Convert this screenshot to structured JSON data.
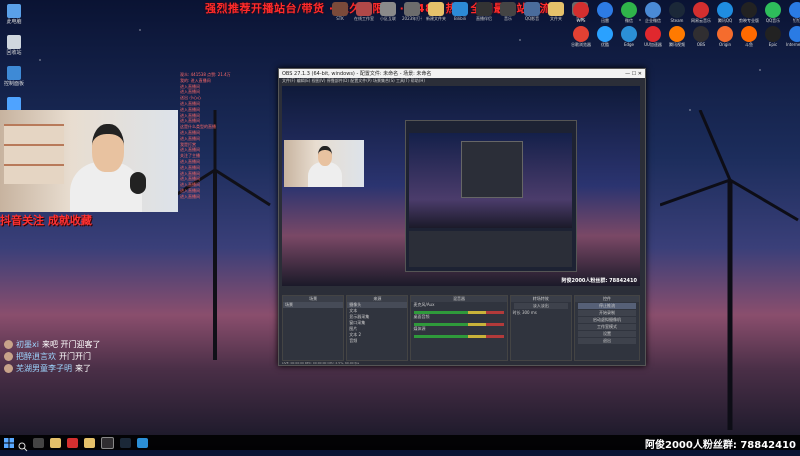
{
  "banner": {
    "text": "强烈推荐开播站台/带货 · 永久无限网 · 8484 热 · 全网最全站台流量"
  },
  "desktop_icons": [
    {
      "label": "此电脑",
      "color": "#5aa0e8",
      "icon": "computer-icon"
    },
    {
      "label": "回收站",
      "color": "#cfd6de",
      "icon": "recycle-bin-icon"
    },
    {
      "label": "控制面板",
      "color": "#3e8ad6",
      "icon": "control-panel-icon"
    },
    {
      "label": "网络",
      "color": "#4fa3ff",
      "icon": "network-icon"
    }
  ],
  "top_apps": [
    {
      "label": "STK",
      "color": "#7a4a3a"
    },
    {
      "label": "在线工作室",
      "color": "#b04848"
    },
    {
      "label": "小区互联",
      "color": "#8a8a8a"
    },
    {
      "label": "2023年打卡",
      "color": "#6c6c6c"
    },
    {
      "label": "新建文件夹",
      "color": "#e5c16a"
    },
    {
      "label": "Bilibili",
      "color": "#2c8ad6"
    },
    {
      "label": "直播伴侣",
      "color": "#333"
    },
    {
      "label": "音乐",
      "color": "#444"
    },
    {
      "label": "QQ影音",
      "color": "#4a6c9c"
    },
    {
      "label": "文件夹",
      "color": "#e5c16a"
    },
    {
      "label": "工具",
      "color": "#6a6a6a"
    }
  ],
  "right_apps": [
    {
      "label": "WPS",
      "color": "#d32f2f"
    },
    {
      "label": "迅雷",
      "color": "#2d7be5"
    },
    {
      "label": "微信",
      "color": "#2fb44a"
    },
    {
      "label": "企业微信",
      "color": "#4a8ad6"
    },
    {
      "label": "Steam",
      "color": "#1b2838"
    },
    {
      "label": "网易云音乐",
      "color": "#d32f2f"
    },
    {
      "label": "腾讯QQ",
      "color": "#1f8de0"
    },
    {
      "label": "剪映专业版",
      "color": "#222"
    },
    {
      "label": "QQ音乐",
      "color": "#2ebd5b"
    },
    {
      "label": "钉钉",
      "color": "#2a7be4"
    },
    {
      "label": "谷歌浏览器",
      "color": "#e34133"
    },
    {
      "label": "优酷",
      "color": "#2aa1ff"
    },
    {
      "label": "Edge",
      "color": "#2b8fd6"
    },
    {
      "label": "UU加速器",
      "color": "#e0282e"
    },
    {
      "label": "腾讯视频",
      "color": "#ff7a00"
    },
    {
      "label": "OBS",
      "color": "#302e31"
    },
    {
      "label": "Origin",
      "color": "#f56c2d"
    },
    {
      "label": "斗鱼",
      "color": "#ff6a00"
    },
    {
      "label": "Epic",
      "color": "#222"
    },
    {
      "label": "Internet Explorer",
      "color": "#2a7be4"
    }
  ],
  "live_overlay": {
    "follow_text": "抖音关注 成就收藏"
  },
  "stats_lines": [
    "观众: 441538  点赞: 21.4万",
    "我的: 进入直播间",
    "进入直播间",
    "进入直播间",
    "送出 小心心",
    "进入直播间",
    "进入直播间",
    "进入直播间",
    "进入直播间",
    "这是什么类型的直播",
    "进入直播间",
    "进入直播间",
    "我是打赏",
    "进入直播间",
    "关注了主播",
    "进入直播间",
    "进入直播间",
    "进入直播间",
    "进入直播间",
    "进入直播间",
    "进入直播间",
    "进入直播间"
  ],
  "comments": [
    {
      "user": "初墨xi",
      "message": "来吧 开门迎客了"
    },
    {
      "user": "把醉逍言欢",
      "message": "开门开门"
    },
    {
      "user": "芜湖男童李子明",
      "message": "来了"
    }
  ],
  "obs": {
    "title": "OBS 27.1.3 (64-bit, windows) - 配置文件: 未命名 - 场景: 未命名",
    "menu": "文件(F)  编辑(E)  视图(V)  停靠部件(D)  配置文件(P)  场景集合(S)  工具(T)  帮助(H)",
    "preview_fans": "阿俊2000人粉丝群: 78842410",
    "panels": {
      "scenes": {
        "header": "场景",
        "items": [
          "场景"
        ]
      },
      "sources": {
        "header": "来源",
        "items": [
          "摄像头",
          "文本",
          "显示器采集",
          "窗口采集",
          "图片",
          "文本 2",
          "音频"
        ]
      },
      "mixer": {
        "header": "混音器",
        "channels": [
          "麦克风/Aux",
          "桌面音频",
          "媒体源"
        ]
      },
      "transitions": {
        "header": "转场特效",
        "type": "淡入淡出",
        "duration_label": "时长",
        "duration": "300 ms"
      },
      "controls": {
        "header": "控件",
        "buttons": [
          "停止推流",
          "开始录制",
          "启动虚拟摄像机",
          "工作室模式",
          "设置",
          "退出"
        ]
      }
    },
    "status": "LIVE: 00:00:00   REC: 00:00:00   CPU: 2.5%, 60.00 fps"
  },
  "taskbar": {
    "fans_text": "阿俊2000人粉丝群: 78842410"
  }
}
